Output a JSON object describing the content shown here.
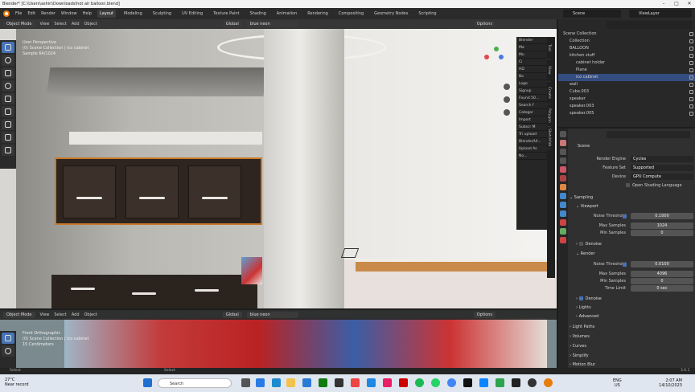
{
  "window": {
    "title": "Blender* [C:\\Users\\ashin\\Downloads\\hot air balloon.blend]"
  },
  "menu": [
    "File",
    "Edit",
    "Render",
    "Window",
    "Help"
  ],
  "workspaces": [
    "Layout",
    "Modeling",
    "Sculpting",
    "UV Editing",
    "Texture Paint",
    "Shading",
    "Animation",
    "Rendering",
    "Compositing",
    "Geometry Nodes",
    "Scripting"
  ],
  "active_workspace": "Layout",
  "scene_name": "Scene",
  "view_layer": "ViewLayer",
  "viewport_top": {
    "mode": "Object Mode",
    "view": "View",
    "select": "Select",
    "add": "Add",
    "object": "Object",
    "orientation": "Global",
    "search_value": "blue neon",
    "options": "Options",
    "overlay_lines": [
      "User Perspective",
      "(0) Scene Collection | ico cabinet",
      "Sample 64/1024"
    ]
  },
  "viewport_bottom": {
    "mode": "Object Mode",
    "view": "View",
    "select": "Select",
    "add": "Add",
    "object": "Object",
    "orientation": "Global",
    "search_value": "blue neon",
    "options": "Options",
    "overlay_lines": [
      "Front Orthographic",
      "(0) Scene Collection | ico cabinet",
      "15 Centimeters"
    ]
  },
  "npanel": {
    "items": [
      "Blender",
      "Ma",
      "Mu",
      "Ci",
      "HD",
      "Bo",
      "Logo",
      "Signup",
      "Found 50...",
      "Search f",
      "Categor",
      "Import",
      "Subscr M",
      "Tri upload",
      "Blender/Ul...",
      "Upload As",
      "No..."
    ],
    "tabs": [
      "Tool",
      "View",
      "Create",
      "Polygon",
      "Sketchfab"
    ]
  },
  "outliner": {
    "search_placeholder": "",
    "rows": [
      {
        "label": "Scene Collection",
        "indent": 0,
        "sel": false
      },
      {
        "label": "Collection",
        "indent": 1,
        "sel": false
      },
      {
        "label": "BALLOON",
        "indent": 1,
        "sel": false
      },
      {
        "label": "kitchen stuff",
        "indent": 1,
        "sel": false
      },
      {
        "label": "cabinet holder",
        "indent": 2,
        "sel": false
      },
      {
        "label": "Plane",
        "indent": 2,
        "sel": false
      },
      {
        "label": "ico cabinet",
        "indent": 2,
        "sel": true
      },
      {
        "label": "wall",
        "indent": 1,
        "sel": false
      },
      {
        "label": "Cube.003",
        "indent": 1,
        "sel": false
      },
      {
        "label": "speaker",
        "indent": 1,
        "sel": false
      },
      {
        "label": "speaker.003",
        "indent": 1,
        "sel": false
      },
      {
        "label": "speaker.005",
        "indent": 1,
        "sel": false
      }
    ]
  },
  "properties": {
    "breadcrumb": "Scene",
    "render_engine_label": "Render Engine",
    "render_engine": "Cycles",
    "feature_set_label": "Feature Set",
    "feature_set": "Supported",
    "device_label": "Device",
    "device": "GPU Compute",
    "osl": "Open Shading Language",
    "sampling": "Sampling",
    "viewport": "Viewport",
    "noise_threshold_label": "Noise Threshold",
    "vp_noise": "0.1000",
    "max_samples_label": "Max Samples",
    "vp_max": "1024",
    "min_samples_label": "Min Samples",
    "vp_min": "0",
    "denoise": "Denoise",
    "render": "Render",
    "r_noise": "0.0100",
    "r_max": "4096",
    "r_min": "0",
    "time_limit_label": "Time Limit",
    "r_time": "0 sec",
    "denoise2": "Denoise",
    "lights": "Lights",
    "advanced": "Advanced",
    "light_paths": "Light Paths",
    "volumes": "Volumes",
    "curves": "Curves",
    "simplify": "Simplify",
    "motion_blur": "Motion Blur"
  },
  "status": {
    "left": "Select",
    "mid": "Select",
    "version": "3.6.1"
  },
  "taskbar": {
    "weather_temp": "27°C",
    "weather_desc": "Near record",
    "search_placeholder": "Search",
    "lang1": "ENG",
    "lang2": "US",
    "time": "2:07 AM",
    "date": "14/10/2023"
  }
}
